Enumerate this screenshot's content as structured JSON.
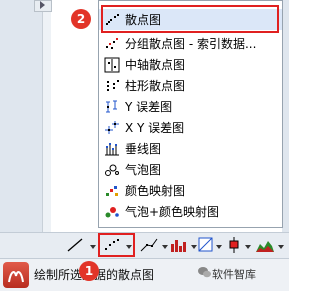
{
  "menu": {
    "items": [
      {
        "label": "散点图",
        "icon": "scatter-icon"
      },
      {
        "label": "分组散点图 - 索引数据...",
        "icon": "grouped-scatter-icon"
      },
      {
        "label": "中轴散点图",
        "icon": "central-axis-scatter-icon"
      },
      {
        "label": "柱形散点图",
        "icon": "column-scatter-icon"
      },
      {
        "label": "Y 误差图",
        "icon": "y-error-icon"
      },
      {
        "label": "X Y 误差图",
        "icon": "xy-error-icon"
      },
      {
        "label": "垂线图",
        "icon": "drop-line-icon"
      },
      {
        "label": "气泡图",
        "icon": "bubble-icon"
      },
      {
        "label": "颜色映射图",
        "icon": "color-map-icon"
      },
      {
        "label": "气泡+颜色映射图",
        "icon": "bubble-color-map-icon"
      }
    ],
    "selected_index": 0
  },
  "annotations": {
    "badge_1": "1",
    "badge_2": "2"
  },
  "status": {
    "text": "绘制所选数据的散点图"
  },
  "watermark": {
    "text": "软件智库"
  },
  "colors": {
    "highlight": "#e02020",
    "badge": "#e23428",
    "selection": "#dbe7f8"
  }
}
